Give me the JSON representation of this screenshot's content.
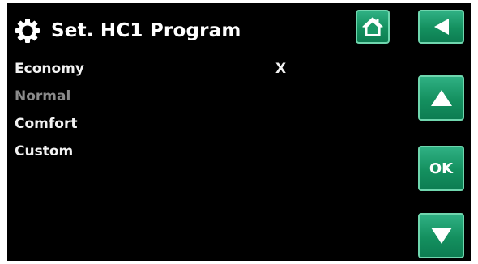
{
  "header": {
    "title": "Set. HC1 Program",
    "icon": "gear-icon"
  },
  "menu": {
    "items": [
      {
        "label": "Economy",
        "state": "normal",
        "selected": true,
        "marker": "X"
      },
      {
        "label": "Normal",
        "state": "dimmed",
        "selected": false,
        "marker": ""
      },
      {
        "label": "Comfort",
        "state": "normal",
        "selected": false,
        "marker": ""
      },
      {
        "label": "Custom",
        "state": "normal",
        "selected": false,
        "marker": ""
      }
    ]
  },
  "buttons": {
    "home": {
      "icon": "home-icon"
    },
    "back": {
      "icon": "back-arrow-icon"
    },
    "up": {
      "icon": "arrow-up-icon"
    },
    "ok": {
      "label": "OK"
    },
    "down": {
      "icon": "arrow-down-icon"
    }
  },
  "colors": {
    "background": "#000000",
    "text": "#ffffff",
    "dimmed_text": "#8a8a8a",
    "button_green": "#14905f",
    "button_border": "#6fd6ae"
  }
}
